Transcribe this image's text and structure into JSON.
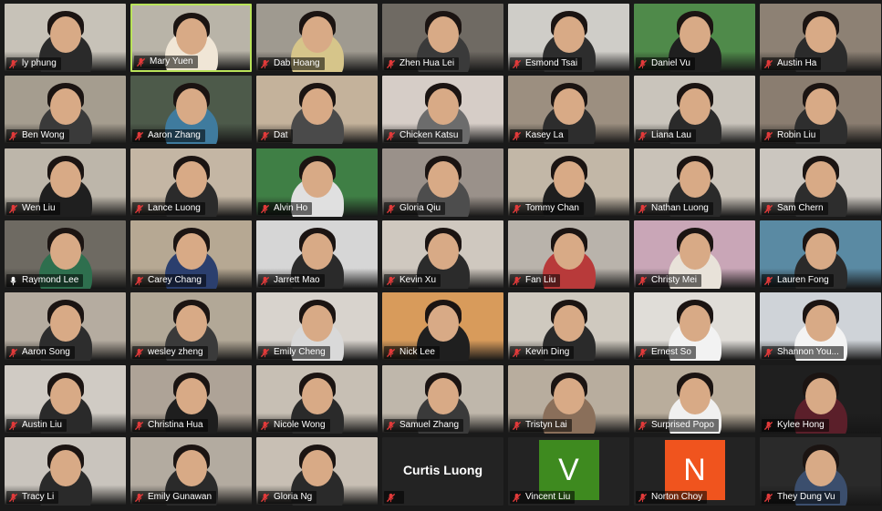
{
  "meeting": {
    "participants": [
      {
        "name": "ly phung",
        "bg": "#c7c2b8",
        "shirt": "#2a2a2a",
        "muted": true
      },
      {
        "name": "Mary Yuen",
        "bg": "#b9b4a8",
        "shirt": "#f0e6d6",
        "muted": true,
        "active": true
      },
      {
        "name": "Dab Hoang",
        "bg": "#9f9a90",
        "shirt": "#d6c58a",
        "muted": true
      },
      {
        "name": "Zhen Hua Lei",
        "bg": "#6f6a63",
        "shirt": "#3a3a3a",
        "muted": true
      },
      {
        "name": "Esmond Tsai",
        "bg": "#cfcdc8",
        "shirt": "#2d2d2d",
        "muted": true
      },
      {
        "name": "Daniel Vu",
        "bg": "#4f8a4a",
        "shirt": "#1f1f1f",
        "muted": true
      },
      {
        "name": "Austin Ha",
        "bg": "#8d8174",
        "shirt": "#2b2b2b",
        "muted": true
      },
      {
        "name": "Ben Wong",
        "bg": "#a59d8f",
        "shirt": "#3a3a3a",
        "muted": true
      },
      {
        "name": "Aaron Zhang",
        "bg": "#4d5a4a",
        "shirt": "#3f7b9e",
        "muted": true
      },
      {
        "name": "Dat",
        "bg": "#c4b29b",
        "shirt": "#4a4a4a",
        "muted": true
      },
      {
        "name": "Chicken Katsu",
        "bg": "#d6cdc7",
        "shirt": "#6c6c6c",
        "muted": true
      },
      {
        "name": "Kasey La",
        "bg": "#9c8f80",
        "shirt": "#2d2d2d",
        "muted": true
      },
      {
        "name": "Liana Lau",
        "bg": "#c9c4bb",
        "shirt": "#2a2a2a",
        "muted": true
      },
      {
        "name": "Robin Liu",
        "bg": "#8a7d70",
        "shirt": "#2e2e2e",
        "muted": true
      },
      {
        "name": "Wen Liu",
        "bg": "#bdb6aa",
        "shirt": "#1f1f1f",
        "muted": true
      },
      {
        "name": "Lance Luong",
        "bg": "#c4b6a4",
        "shirt": "#2b2b2b",
        "muted": true
      },
      {
        "name": "Alvin Ho",
        "bg": "#3f7f45",
        "shirt": "#e0e0e0",
        "muted": true
      },
      {
        "name": "Gloria Qiu",
        "bg": "#9a918a",
        "shirt": "#4d4d4d",
        "muted": true
      },
      {
        "name": "Tommy Chan",
        "bg": "#c2b7a7",
        "shirt": "#1f1f1f",
        "muted": true
      },
      {
        "name": "Nathan Luong",
        "bg": "#c9c2b8",
        "shirt": "#2a2a2a",
        "muted": true
      },
      {
        "name": "Sam Chern",
        "bg": "#cbc6bf",
        "shirt": "#2d2d2d",
        "muted": true
      },
      {
        "name": "Raymond Lee",
        "bg": "#6e6a62",
        "shirt": "#2e6f4e",
        "muted": false
      },
      {
        "name": "Carey Chang",
        "bg": "#b6a893",
        "shirt": "#2b3f6e",
        "muted": true
      },
      {
        "name": "Jarrett Mao",
        "bg": "#d6d6d6",
        "shirt": "#2a2a2a",
        "muted": true
      },
      {
        "name": "Kevin Xu",
        "bg": "#cfc8bf",
        "shirt": "#2b2b2b",
        "muted": true
      },
      {
        "name": "Fan Liu",
        "bg": "#b9b3ab",
        "shirt": "#b83a3a",
        "muted": true
      },
      {
        "name": "Christy Mei",
        "bg": "#c9a6b7",
        "shirt": "#e8e2d9",
        "muted": true
      },
      {
        "name": "Lauren Fong",
        "bg": "#5a8aa3",
        "shirt": "#2a2a2a",
        "muted": true
      },
      {
        "name": "Aaron Song",
        "bg": "#b5aca0",
        "shirt": "#2d2d2d",
        "muted": true
      },
      {
        "name": "wesley zheng",
        "bg": "#b2a897",
        "shirt": "#3a3a3a",
        "muted": true
      },
      {
        "name": "Emily Cheng",
        "bg": "#d8d3cd",
        "shirt": "#d9d9d9",
        "muted": true
      },
      {
        "name": "Nick Lee",
        "bg": "#d89b5b",
        "shirt": "#1f1f1f",
        "muted": true
      },
      {
        "name": "Kevin Ding",
        "bg": "#cfc9bf",
        "shirt": "#2a2a2a",
        "muted": true
      },
      {
        "name": "Ernest So",
        "bg": "#e0ddd8",
        "shirt": "#f2f2f2",
        "muted": true
      },
      {
        "name": "Shannon You...",
        "bg": "#cfd3d8",
        "shirt": "#f3f3f3",
        "muted": true
      },
      {
        "name": "Austin Liu",
        "bg": "#d0cbc4",
        "shirt": "#2a2a2a",
        "muted": true
      },
      {
        "name": "Christina Hua",
        "bg": "#aea397",
        "shirt": "#1e1e1e",
        "muted": true
      },
      {
        "name": "Nicole Wong",
        "bg": "#c7bfb4",
        "shirt": "#2a2a2a",
        "muted": true
      },
      {
        "name": "Samuel Zhang",
        "bg": "#bfb7ab",
        "shirt": "#3a3a3a",
        "muted": true
      },
      {
        "name": "Tristyn Lai",
        "bg": "#b8ad9e",
        "shirt": "#8a6f5a",
        "muted": true
      },
      {
        "name": "Surprised Popo",
        "bg": "#b9ad9c",
        "shirt": "#f0f0f0",
        "muted": true
      },
      {
        "name": "Kylee Hong",
        "bg": "#1f1f1f",
        "shirt": "#5b1f2a",
        "muted": true
      },
      {
        "name": "Tracy Li",
        "bg": "#c9c4bd",
        "shirt": "#2a2a2a",
        "muted": true
      },
      {
        "name": "Emily Gunawan",
        "bg": "#b3aba0",
        "shirt": "#2a2a2a",
        "muted": true
      },
      {
        "name": "Gloria Ng",
        "bg": "#c8bfb4",
        "shirt": "#2a2a2a",
        "muted": true
      },
      {
        "name": "Curtis Luong",
        "placeholder": "text",
        "muted": true
      },
      {
        "name": "Vincent Liu",
        "placeholder": "avatar",
        "letter": "V",
        "avatar_color": "#3e8a1f",
        "muted": true
      },
      {
        "name": "Norton Choy",
        "placeholder": "avatar",
        "letter": "N",
        "avatar_color": "#f0541e",
        "muted": true
      },
      {
        "name": "They Dung Vu",
        "bg": "#2a2a2a",
        "shirt": "#3b4e6d",
        "muted": true
      }
    ]
  }
}
